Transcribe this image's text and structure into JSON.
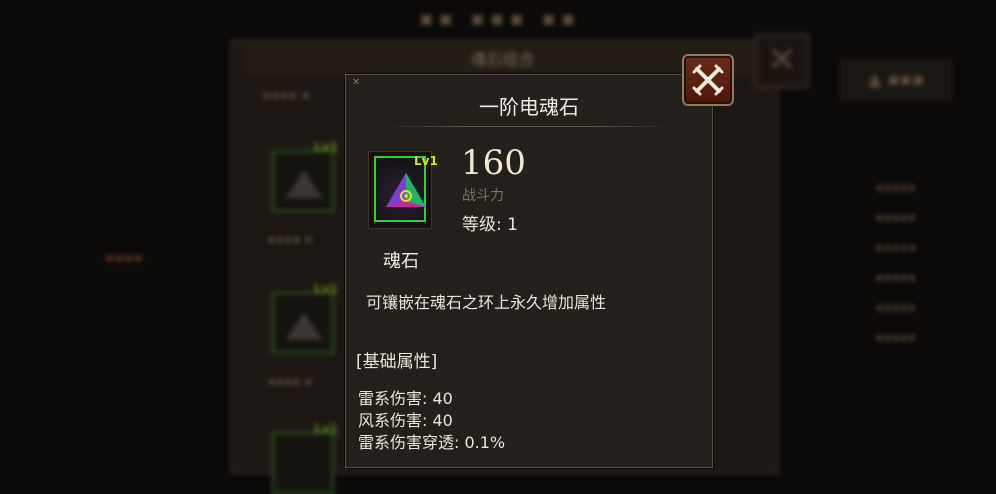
{
  "tooltip": {
    "title": "一阶电魂石",
    "item": {
      "level_badge": "Lv1",
      "name": "魂石",
      "icon": "triangle-soul-stone-icon"
    },
    "power": {
      "value": "160",
      "label": "战斗力"
    },
    "level_text": "等级: 1",
    "description": "可镶嵌在魂石之环上永久增加属性",
    "section_title": "[基础属性]",
    "attributes": [
      "雷系伤害: 40",
      "风系伤害: 40",
      "雷系伤害穿透: 0.1%"
    ]
  },
  "background": {
    "panel_header": "魂石组合",
    "slot_badge": "Lv1"
  },
  "colors": {
    "accent_green": "#2cd12c",
    "level_yellow": "#d6e21a",
    "close_red": "#5b1f10"
  }
}
